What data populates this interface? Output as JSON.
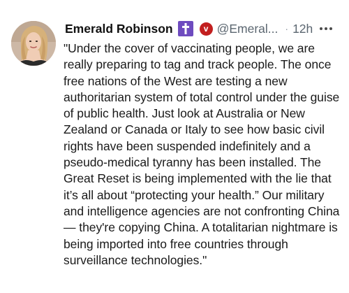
{
  "post": {
    "author": {
      "display_name": "Emerald Robinson",
      "handle": "@Emeral...",
      "avatar_icon": "profile-photo",
      "badges": [
        "cross-icon",
        "verified-v-icon"
      ],
      "v_badge_letter": "v"
    },
    "separator": "·",
    "time": "12h",
    "more_icon": "more-dots-icon",
    "text": "\"Under the cover of vaccinating people, we are really preparing to tag and track people. The once free nations of the West are testing a new authoritarian system of total control under the guise of public health. Just look at Australia or New Zealand or Canada or Italy to see how basic civil rights have been suspended indefinitely and a pseudo-medical tyranny has been installed. The Great Reset is being implemented with the lie that it’s all about “protecting your health.” Our military and intelligence agencies are not confronting China — they're copying China. A totalitarian nightmare is being imported into free countries through surveillance technologies.\""
  },
  "colors": {
    "cross_badge": "#6e4bbf",
    "v_badge": "#c21f1f",
    "secondary_text": "#5b6670"
  }
}
